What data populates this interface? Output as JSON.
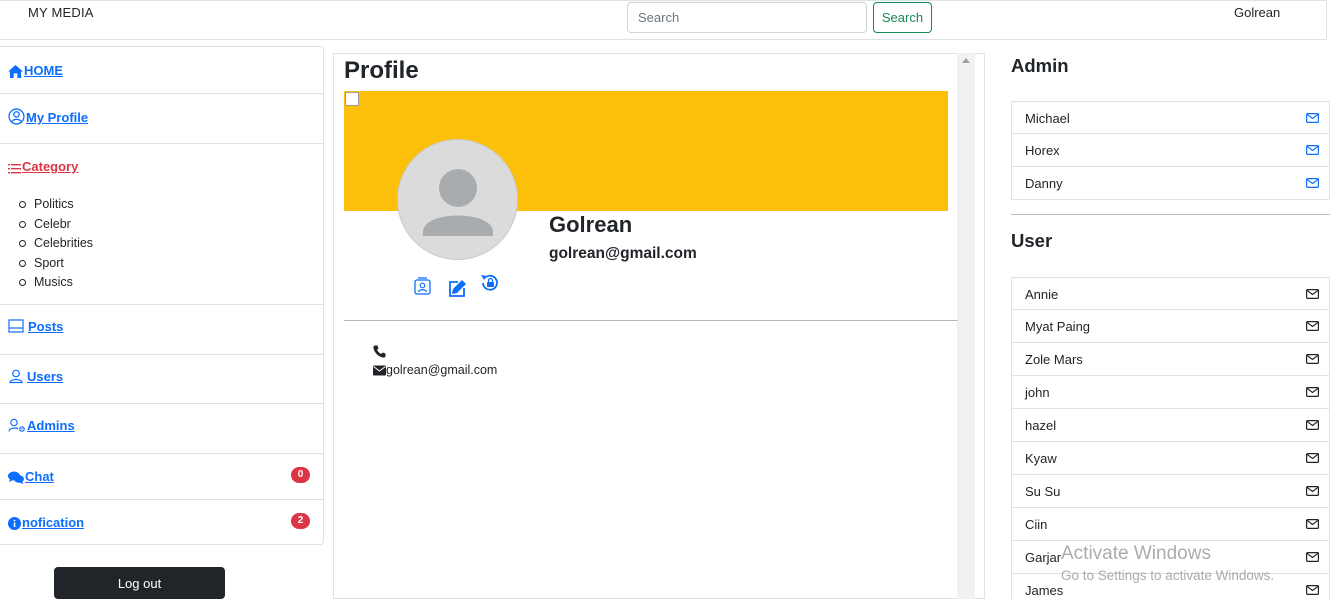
{
  "navbar": {
    "brand": "MY MEDIA",
    "search_placeholder": "Search",
    "search_button": "Search",
    "user_name": "Golrean"
  },
  "sidebar": {
    "home": "HOME",
    "my_profile": "My Profile",
    "category": "Category",
    "categories": [
      "Politics",
      "Celebr",
      "Celebrities",
      "Sport",
      "Musics"
    ],
    "posts": "Posts",
    "users": "Users",
    "admins": "Admins",
    "chat": "Chat",
    "chat_badge": "0",
    "notification": "nofication",
    "notification_badge": "2",
    "logout": "Log out"
  },
  "profile": {
    "title": "Profile",
    "name": "Golrean",
    "email": "golrean@gmail.com",
    "contact_email": "golrean@gmail.com",
    "contact_phone": ""
  },
  "admins": {
    "title": "Admin",
    "items": [
      "Michael",
      "Horex",
      "Danny"
    ]
  },
  "users": {
    "title": "User",
    "items": [
      "Annie",
      "Myat Paing",
      "Zole Mars",
      "john",
      "hazel",
      "Kyaw",
      "Su Su",
      "Ciin",
      "Garjar",
      "James"
    ]
  },
  "watermark": {
    "line1": "Activate Windows",
    "line2": "Go to Settings to activate Windows."
  },
  "colors": {
    "link": "#0d6efd",
    "category": "#dc3545",
    "cover": "#fcc00b",
    "search_button": "#198754",
    "badge": "#dc3545"
  }
}
